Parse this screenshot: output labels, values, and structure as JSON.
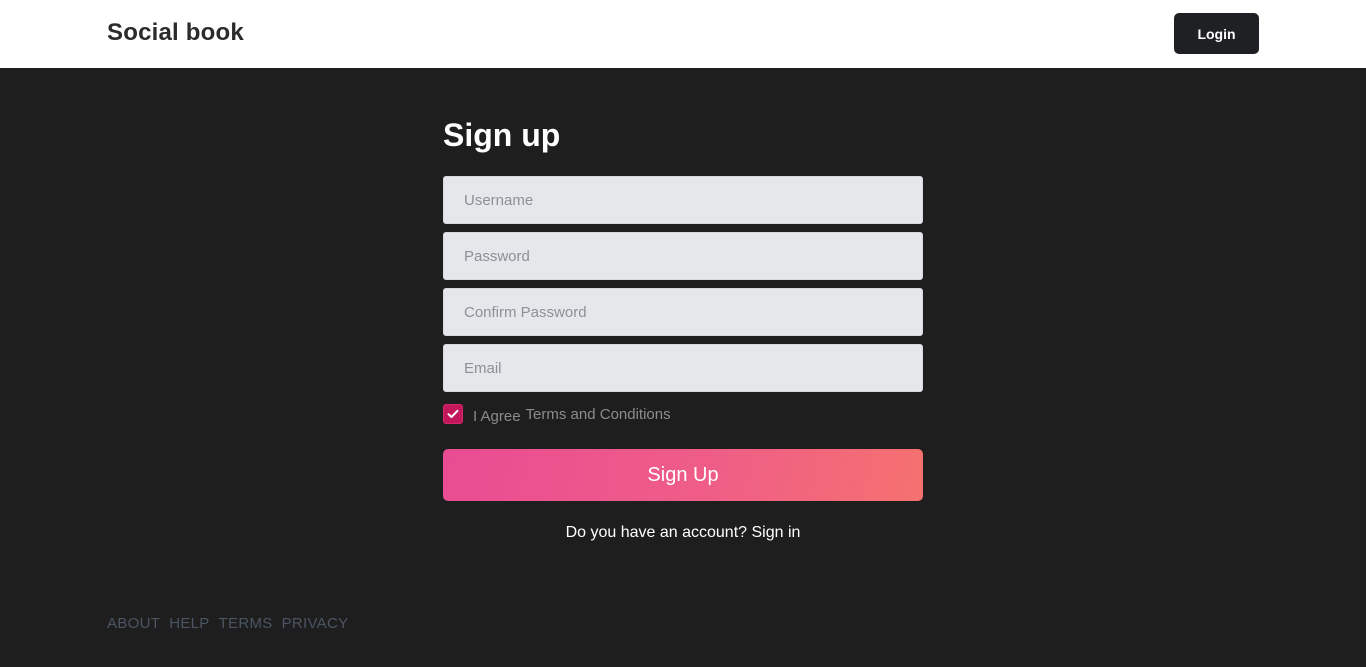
{
  "header": {
    "brand": "Social book",
    "login_label": "Login"
  },
  "form": {
    "title": "Sign up",
    "username_placeholder": "Username",
    "password_placeholder": "Password",
    "confirm_password_placeholder": "Confirm Password",
    "email_placeholder": "Email",
    "agree_checked": true,
    "agree_label": "I Agree",
    "terms_link": "Terms and Conditions",
    "submit_label": "Sign Up",
    "signin_prompt": "Do you have an account?",
    "signin_link": "Sign in"
  },
  "footer": {
    "links": [
      "ABOUT",
      "HELP",
      "TERMS",
      "PRIVACY"
    ]
  },
  "colors": {
    "header_bg": "#ffffff",
    "page_bg": "#1e1e1e",
    "accent_start": "#e94c93",
    "accent_end": "#f5716f",
    "checkbox": "#c2185b"
  },
  "icons": {
    "checkbox_mark": "check-icon"
  }
}
